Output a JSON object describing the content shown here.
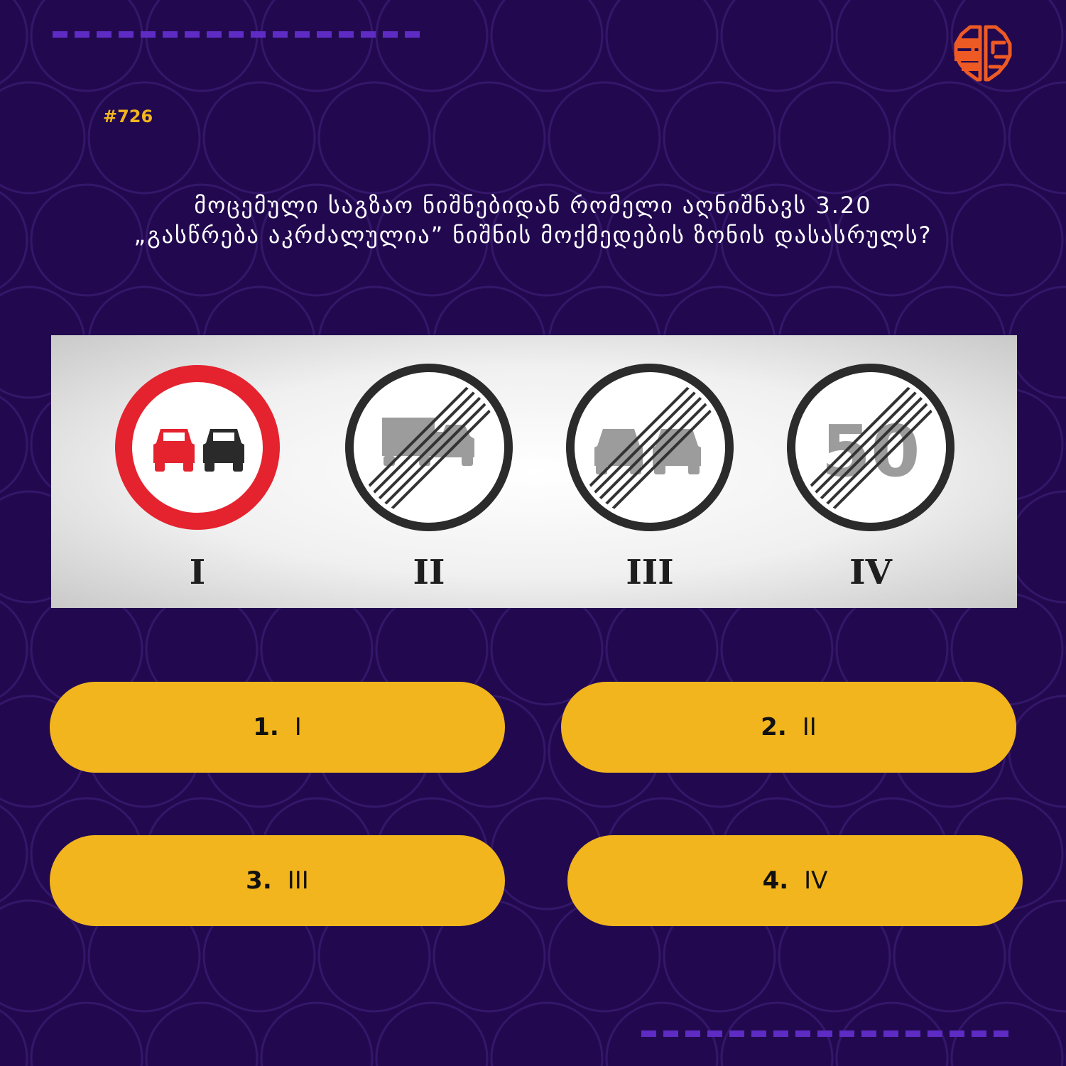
{
  "question": {
    "number": "#726",
    "line1": "მოცემული საგზაო ნიშნებიდან რომელი აღნიშნავს 3.20",
    "line2": "„გასწრება აკრძალულია” ნიშნის მოქმედების ზონის დასასრულს?"
  },
  "signs": [
    {
      "label": "I",
      "icon": "no-overtaking-sign"
    },
    {
      "label": "II",
      "icon": "end-of-no-overtaking-trucks-sign"
    },
    {
      "label": "III",
      "icon": "end-of-no-overtaking-sign"
    },
    {
      "label": "IV",
      "icon": "end-of-speed-limit-sign",
      "speed": "50"
    }
  ],
  "answers": [
    {
      "num": "1.",
      "text": "I"
    },
    {
      "num": "2.",
      "text": "II"
    },
    {
      "num": "3.",
      "text": "III"
    },
    {
      "num": "4.",
      "text": "IV"
    }
  ],
  "colors": {
    "background": "#22094f",
    "accent": "#f2b51d",
    "dash": "#5e2bc4",
    "logo": "#ee5a24",
    "sign_red": "#e4232f"
  }
}
